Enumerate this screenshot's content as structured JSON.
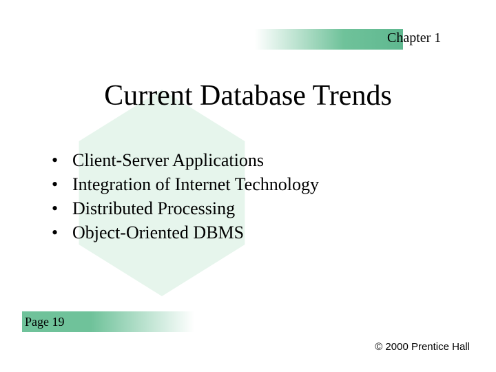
{
  "header": {
    "chapter_label": "Chapter 1"
  },
  "title": "Current Database Trends",
  "bullets": [
    "Client-Server Applications",
    "Integration of Internet Technology",
    "Distributed Processing",
    "Object-Oriented DBMS"
  ],
  "footer": {
    "page_label": "Page 19",
    "copyright": "© 2000 Prentice Hall"
  }
}
